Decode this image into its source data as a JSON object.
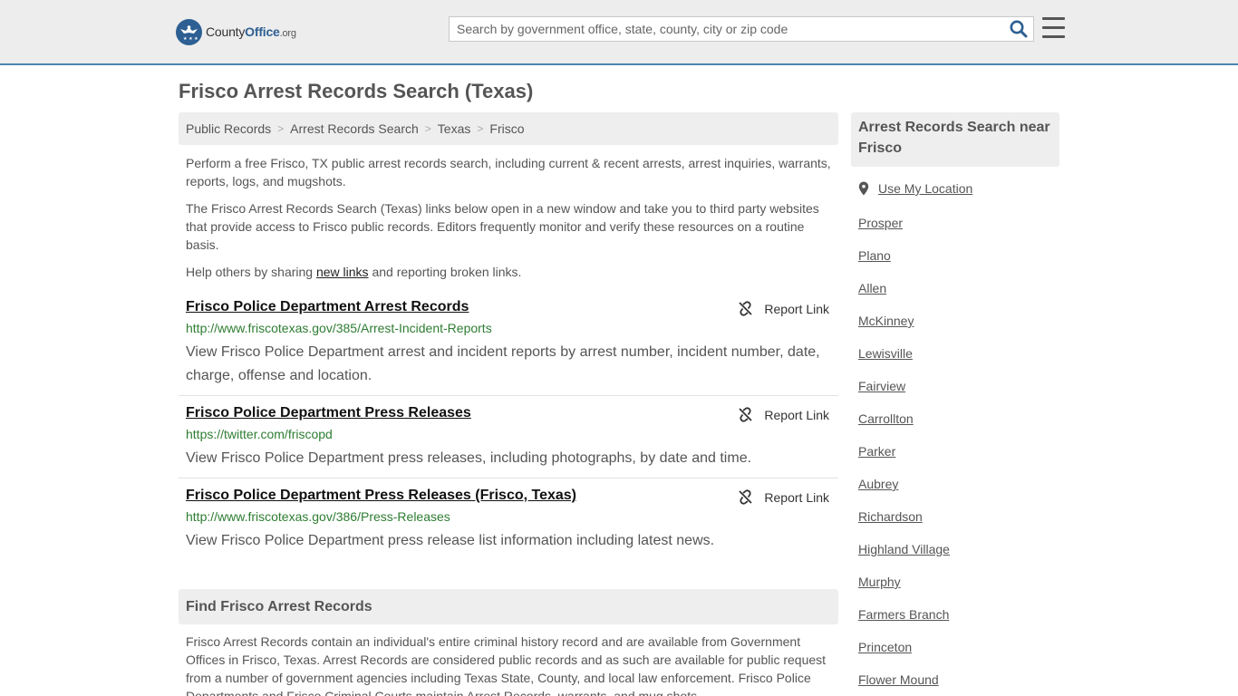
{
  "header": {
    "logo_prefix": "County",
    "logo_strong": "Office",
    "logo_tld": ".org",
    "search_placeholder": "Search by government office, state, county, city or zip code"
  },
  "page": {
    "title": "Frisco Arrest Records Search (Texas)"
  },
  "breadcrumb": [
    "Public Records",
    "Arrest Records Search",
    "Texas",
    "Frisco"
  ],
  "intro": {
    "p1": "Perform a free Frisco, TX public arrest records search, including current & recent arrests, arrest inquiries, warrants, reports, logs, and mugshots.",
    "p2": "The Frisco Arrest Records Search (Texas) links below open in a new window and take you to third party websites that provide access to Frisco public records. Editors frequently monitor and verify these resources on a routine basis.",
    "p3_before": "Help others by sharing ",
    "p3_link": "new links",
    "p3_after": " and reporting broken links."
  },
  "links": [
    {
      "title": "Frisco Police Department Arrest Records",
      "url": "http://www.friscotexas.gov/385/Arrest-Incident-Reports",
      "description": "View Frisco Police Department arrest and incident reports by arrest number, incident number, date, charge, offense and location.",
      "report_label": "Report Link"
    },
    {
      "title": "Frisco Police Department Press Releases",
      "url": "https://twitter.com/friscopd",
      "description": "View Frisco Police Department press releases, including photographs, by date and time.",
      "report_label": "Report Link"
    },
    {
      "title": "Frisco Police Department Press Releases (Frisco, Texas)",
      "url": "http://www.friscotexas.gov/386/Press-Releases",
      "description": "View Frisco Police Department press release list information including latest news.",
      "report_label": "Report Link"
    }
  ],
  "find_section": {
    "heading": "Find Frisco Arrest Records",
    "body": "Frisco Arrest Records contain an individual's entire criminal history record and are available from Government Offices in Frisco, Texas. Arrest Records are considered public records and as such are available for public request from a number of government agencies including Texas State, County, and local law enforcement. Frisco Police Departments and Frisco Criminal Courts maintain Arrest Records, warrants, and mug shots."
  },
  "sidebar": {
    "heading": "Arrest Records Search near Frisco",
    "use_location": "Use My Location",
    "cities": [
      "Prosper",
      "Plano",
      "Allen",
      "McKinney",
      "Lewisville",
      "Fairview",
      "Carrollton",
      "Parker",
      "Aubrey",
      "Richardson",
      "Highland Village",
      "Murphy",
      "Farmers Branch",
      "Princeton",
      "Flower Mound"
    ]
  },
  "colors": {
    "header_bg": "#ededed",
    "header_border": "#4a86b4",
    "brand_blue": "#2d5f93",
    "url_green": "#2e7d32",
    "panel_bg": "#eeeeee",
    "text": "#555555"
  }
}
